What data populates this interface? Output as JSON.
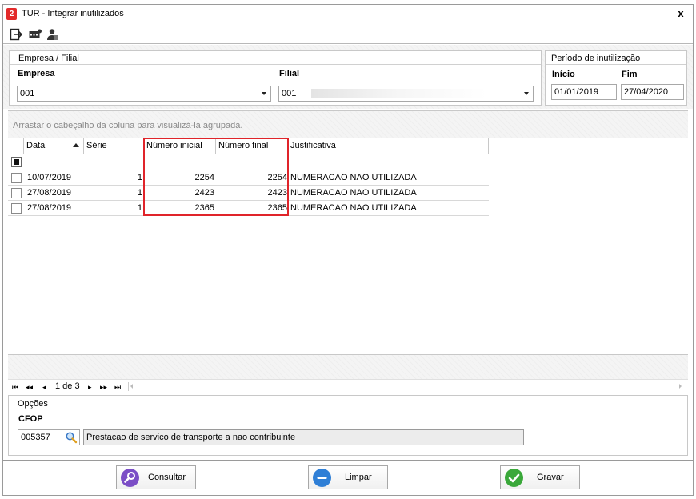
{
  "window": {
    "title": "TUR - Integrar inutilizados",
    "app_icon_glyph": "2",
    "minimize_glyph": "_",
    "close_glyph": "x"
  },
  "toolbar": {
    "icons": [
      "exit-icon",
      "batch-icon",
      "user-icon"
    ]
  },
  "empresa_filial": {
    "group_title": "Empresa / Filial",
    "empresa_label": "Empresa",
    "empresa_value": "001",
    "filial_label": "Filial",
    "filial_value": "001"
  },
  "periodo": {
    "group_title": "Período de inutilização",
    "inicio_label": "Início",
    "inicio_value": "01/01/2019",
    "fim_label": "Fim",
    "fim_value": "27/04/2020"
  },
  "grid": {
    "group_hint": "Arrastar o cabeçalho da coluna para visualizá-la agrupada.",
    "columns": [
      "Data",
      "Série",
      "Número inicial",
      "Número final",
      "Justificativa"
    ],
    "rows": [
      {
        "data": "10/07/2019",
        "serie": "1",
        "numero_inicial": "2254",
        "numero_final": "2254",
        "justificativa": "NUMERACAO NAO UTILIZADA"
      },
      {
        "data": "27/08/2019",
        "serie": "1",
        "numero_inicial": "2423",
        "numero_final": "2423",
        "justificativa": "NUMERACAO NAO UTILIZADA"
      },
      {
        "data": "27/08/2019",
        "serie": "1",
        "numero_inicial": "2365",
        "numero_final": "2365",
        "justificativa": "NUMERACAO NAO UTILIZADA"
      }
    ],
    "highlight_color": "#e0242a"
  },
  "pager": {
    "first": "⏮",
    "prev_page": "◂◂",
    "prev": "◂",
    "position": "1 de 3",
    "next": "▸",
    "next_page": "▸▸",
    "last": "⏭"
  },
  "opcoes": {
    "group_title": "Opções",
    "cfop_label": "CFOP",
    "cfop_value": "005357",
    "cfop_description": "Prestacao de servico de transporte a nao contribuinte"
  },
  "buttons": {
    "consultar": "Consultar",
    "limpar": "Limpar",
    "gravar": "Gravar"
  },
  "colors": {
    "consultar_icon": "#7b4ec6",
    "limpar_icon": "#2f7fd6",
    "gravar_icon": "#3aa83a"
  }
}
